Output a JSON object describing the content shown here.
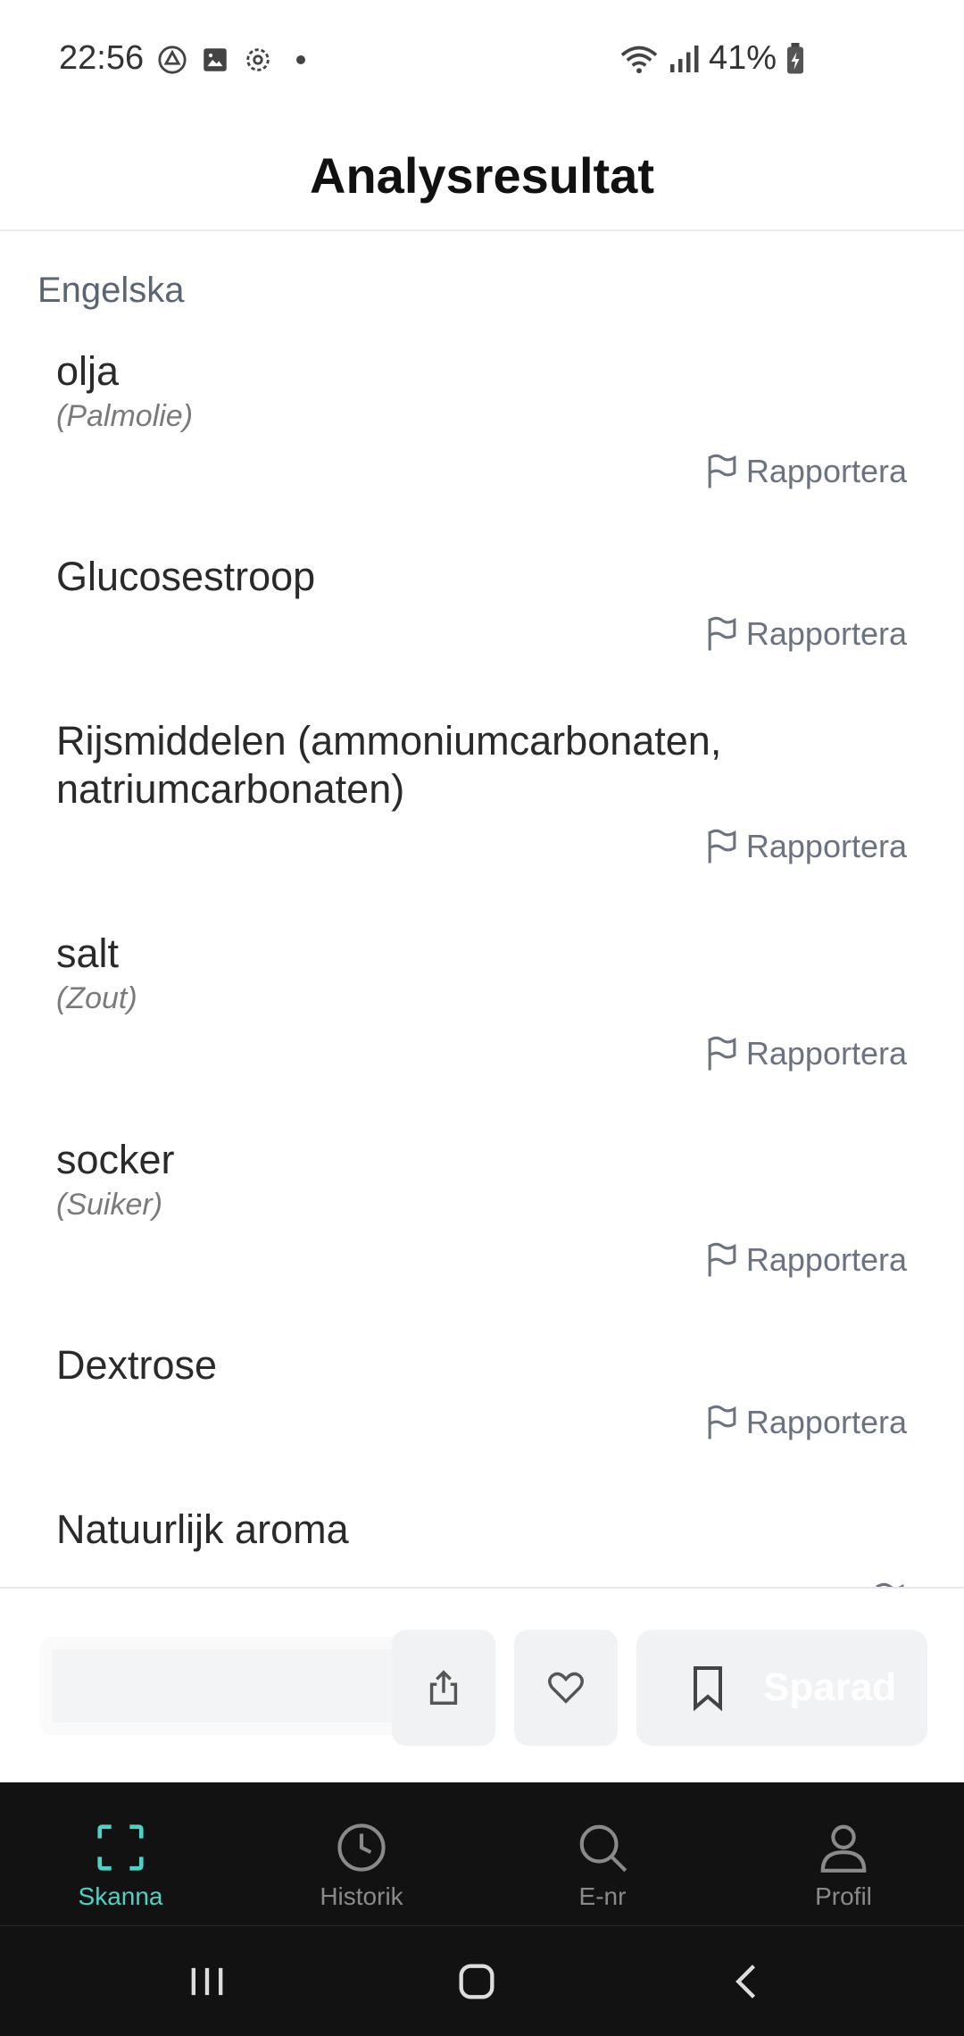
{
  "status_bar": {
    "time": "22:56",
    "battery": "41%",
    "icons": [
      "drive-icon",
      "image-icon",
      "gear-icon",
      "wifi-icon",
      "signal-icon",
      "battery-icon"
    ]
  },
  "header": {
    "title": "Analysresultat"
  },
  "section": {
    "label": "Engelska"
  },
  "items": [
    {
      "name": "olja",
      "sub": "(Palmolie)",
      "report": "Rapportera"
    },
    {
      "name": "Glucosestroop",
      "sub": "",
      "report": "Rapportera"
    },
    {
      "name": "Rijsmiddelen (ammoniumcarbonaten, natriumcarbonaten)",
      "sub": "",
      "report": "Rapportera"
    },
    {
      "name": "salt",
      "sub": "(Zout)",
      "report": "Rapportera"
    },
    {
      "name": "socker",
      "sub": "(Suiker)",
      "report": "Rapportera"
    },
    {
      "name": "Dextrose",
      "sub": "",
      "report": "Rapportera"
    },
    {
      "name": "Natuurlijk aroma",
      "sub": "",
      "report": ""
    }
  ],
  "actions": {
    "save_label": "Sparad"
  },
  "bottom_nav": [
    {
      "label": "Skanna",
      "icon": "scan-icon",
      "active": true
    },
    {
      "label": "Historik",
      "icon": "clock-icon",
      "active": false
    },
    {
      "label": "E-nr",
      "icon": "search-icon",
      "active": false
    },
    {
      "label": "Profil",
      "icon": "user-icon",
      "active": false
    }
  ],
  "colors": {
    "accent": "#4fd1c5",
    "nav_background": "#121212",
    "muted_text": "#6b7280"
  }
}
